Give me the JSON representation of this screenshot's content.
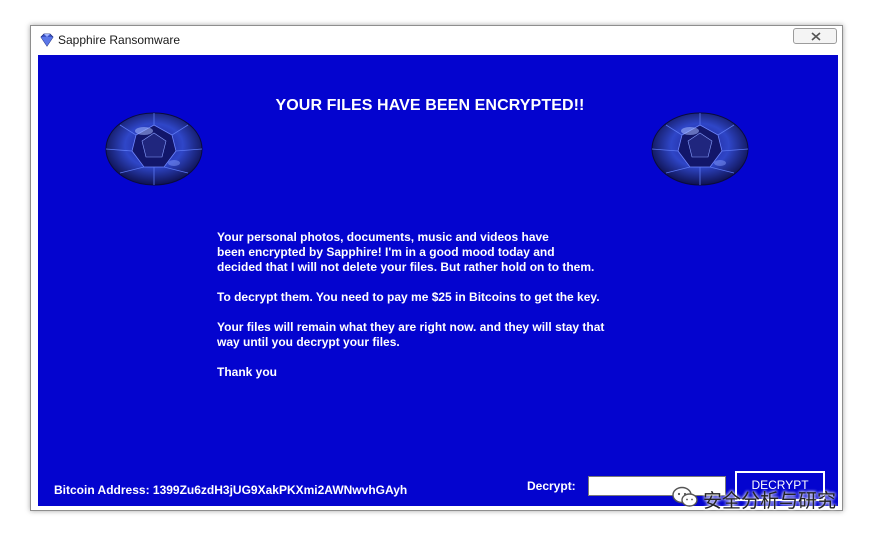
{
  "window": {
    "title": "Sapphire Ransomware",
    "app_icon": "diamond-icon",
    "close_icon": "close-icon"
  },
  "theme": {
    "background": "#0404cf",
    "text": "#ffffff"
  },
  "headline": "YOUR FILES HAVE BEEN ENCRYPTED!!",
  "message": {
    "paragraph1_line1": "Your personal photos, documents, music and videos have",
    "paragraph1_line2": "been encrypted by Sapphire! I'm in a good mood today and",
    "paragraph1_line3": "decided that I will not delete your files. But rather hold on to them.",
    "paragraph2": "To decrypt them. You need to pay me $25 in Bitcoins to get the key.",
    "paragraph3_line1": "Your files will remain what they are right now. and they will stay that",
    "paragraph3_line2": "way until you decrypt your files.",
    "closing": "Thank you"
  },
  "bitcoin_address": "Bitcoin Address: 1399Zu6zdH3jUG9XakPKXmi2AWNwvhGAyh",
  "decrypt": {
    "label": "Decrypt:",
    "input_value": "",
    "button_label": "DECRYPT"
  },
  "watermark": {
    "text": "安全分析与研究",
    "icon": "wechat-icon"
  }
}
